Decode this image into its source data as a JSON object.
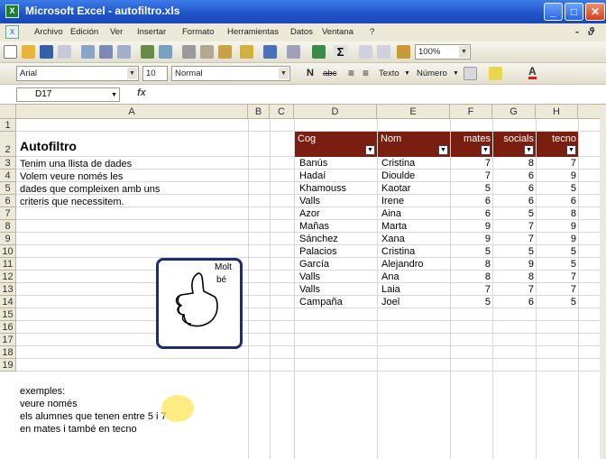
{
  "window": {
    "title": "Microsoft Excel - autofiltro.xls"
  },
  "menubar": {
    "items": [
      "Archivo",
      "Edición",
      "Ver",
      "Insertar",
      "Formato",
      "Herramientas",
      "Datos",
      "Ventana",
      "?"
    ]
  },
  "toolbar1": {
    "zoom": "100%"
  },
  "toolbar2": {
    "font": "Arial",
    "size": "10",
    "style": "Normal",
    "bold": "N",
    "italic": "abc",
    "text_btn": "Texto",
    "number_btn": "Número"
  },
  "formula": {
    "cell_ref": "D17",
    "fx": "fx"
  },
  "columns": [
    "A",
    "B",
    "C",
    "D",
    "E",
    "F",
    "G",
    "H"
  ],
  "rows": [
    "1",
    "2",
    "3",
    "4",
    "5",
    "6",
    "7",
    "8",
    "9",
    "10",
    "11",
    "12",
    "13",
    "14",
    "15",
    "16",
    "17",
    "18",
    "19"
  ],
  "title_cell": "Autofiltro",
  "intro": [
    "Tenim una llista de dades",
    "Volem veure només les",
    "dades que compleixen amb uns",
    "criteris que necessitem."
  ],
  "headers": [
    "Cog",
    "Nom",
    "mates",
    "socials",
    "tecno"
  ],
  "table": [
    [
      "Banús",
      "Cristina",
      "7",
      "8",
      "7"
    ],
    [
      "Hadaí",
      "Dioulde",
      "7",
      "6",
      "9"
    ],
    [
      "Khamouss",
      "Kaotar",
      "5",
      "6",
      "5"
    ],
    [
      "Valls",
      "Irene",
      "6",
      "6",
      "6"
    ],
    [
      "Azor",
      "Aina",
      "6",
      "5",
      "8"
    ],
    [
      "Mañas",
      "Marta",
      "9",
      "7",
      "9"
    ],
    [
      "Sánchez",
      "Xana",
      "9",
      "7",
      "9"
    ],
    [
      "Palacios",
      "Cristina",
      "5",
      "5",
      "5"
    ],
    [
      "García",
      "Alejandro",
      "8",
      "9",
      "5"
    ],
    [
      "Valls",
      "Ana",
      "8",
      "8",
      "7"
    ],
    [
      "Valls",
      "Laia",
      "7",
      "7",
      "7"
    ],
    [
      "Campaña",
      "Joel",
      "5",
      "6",
      "5"
    ]
  ],
  "examples": [
    "exemples:",
    "veure només",
    "els alumnes que tenen entre 5 i 7",
    "en mates i també en tecno"
  ],
  "thumb_text": [
    "Molt",
    "bé"
  ]
}
